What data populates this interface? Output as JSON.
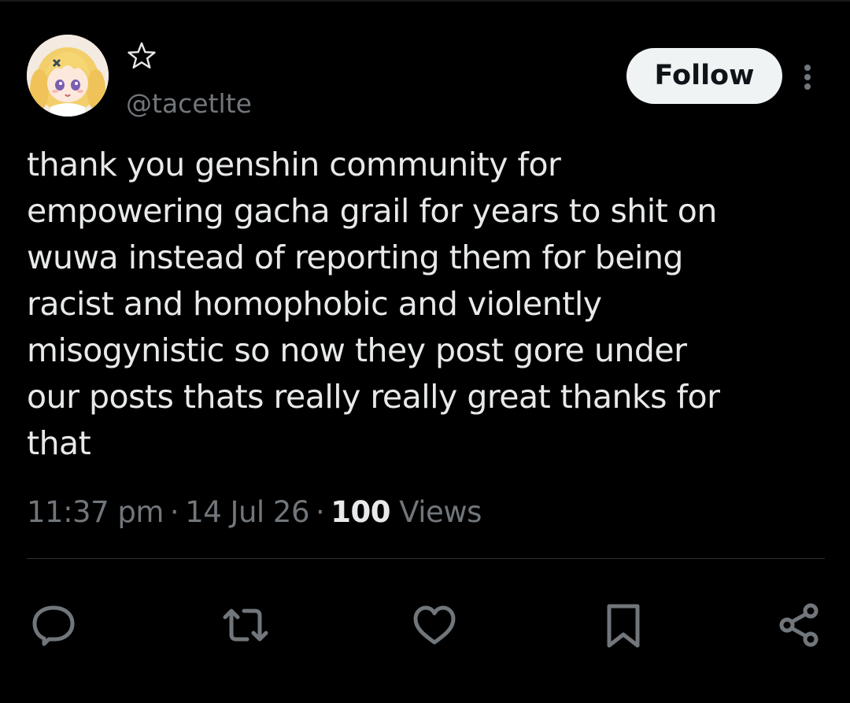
{
  "author": {
    "display_name_icon": "star-icon",
    "handle": "@tacetlte",
    "avatar_icon": "anime-avatar"
  },
  "header": {
    "follow_label": "Follow",
    "more_icon": "more-options-icon"
  },
  "tweet": {
    "text": "thank you genshin community for\nempowering gacha grail for years to shit on\nwuwa instead of reporting them for being\nracist and homophobic and violently\nmisogynistic so now they post gore under\nour posts thats really really great thanks for\nthat",
    "time": "11:37 pm",
    "date": "14 Jul 26",
    "separator": "·",
    "views_count": "100",
    "views_label": "Views"
  },
  "actions": [
    {
      "icon": "reply-icon"
    },
    {
      "icon": "retweet-icon"
    },
    {
      "icon": "like-icon"
    },
    {
      "icon": "bookmark-icon"
    },
    {
      "icon": "share-icon"
    }
  ],
  "colors": {
    "background": "#000000",
    "text_primary": "#e7e9ea",
    "text_secondary": "#71767b",
    "follow_bg": "#eff3f4",
    "follow_text": "#0f1419",
    "divider": "#2f3336"
  }
}
